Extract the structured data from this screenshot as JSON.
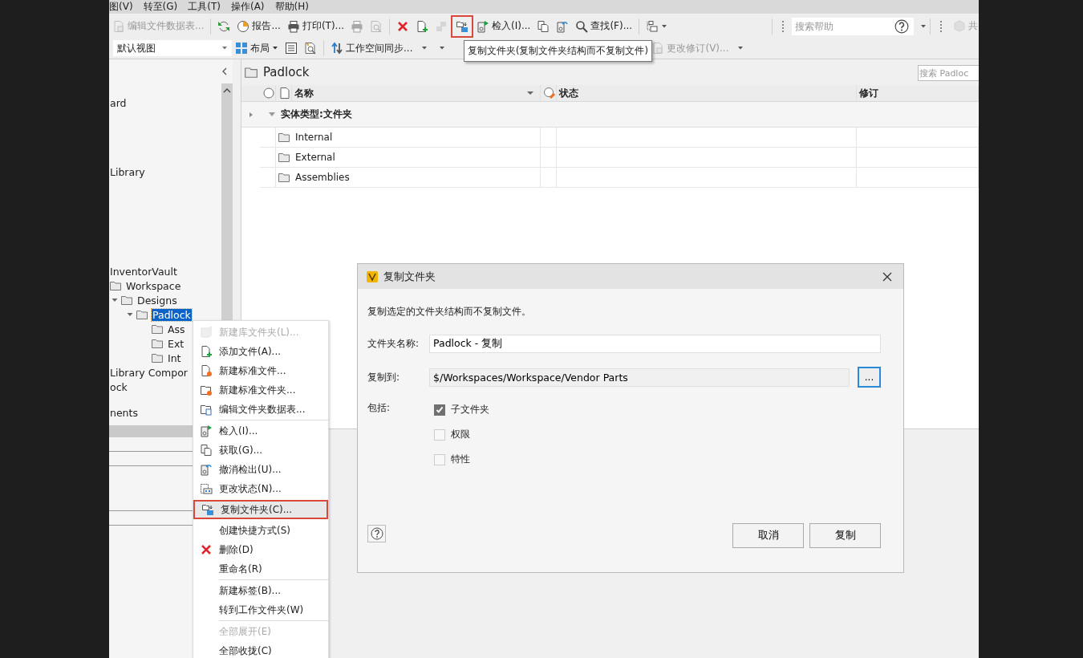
{
  "menu_bar": [
    "图(V)",
    "转至(G)",
    "工具(T)",
    "操作(A)",
    "帮助(H)"
  ],
  "toolbar": [
    {
      "kind": "button",
      "label": "编辑文件数据表...",
      "disabled": true
    },
    {
      "kind": "separator"
    },
    {
      "kind": "icon",
      "disabled": false
    },
    {
      "kind": "button",
      "label": "报告...",
      "disabled": false
    },
    {
      "kind": "button",
      "label": "打印(T)...",
      "disabled": false
    },
    {
      "kind": "icon",
      "disabled": true
    },
    {
      "kind": "icon",
      "disabled": true
    },
    {
      "kind": "separator"
    },
    {
      "kind": "icon",
      "disabled": false
    },
    {
      "kind": "icon",
      "disabled": false
    },
    {
      "kind": "icon",
      "disabled": true
    },
    {
      "kind": "icon",
      "disabled": false,
      "highlighted": true
    },
    {
      "kind": "button",
      "label": "检入(I)...",
      "disabled": false
    },
    {
      "kind": "icon",
      "disabled": false
    },
    {
      "kind": "icon",
      "disabled": false
    },
    {
      "kind": "button",
      "label": "查找(F)...",
      "disabled": false
    },
    {
      "kind": "separator"
    },
    {
      "kind": "icon-menu",
      "disabled": false
    }
  ],
  "help_search": {
    "placeholder": "搜索帮助"
  },
  "toolbar_cut_label": "共",
  "toolbar2": [
    {
      "kind": "dropdown",
      "value": "默认视图"
    },
    {
      "kind": "menu-button",
      "label": "布局"
    },
    {
      "kind": "icon"
    },
    {
      "kind": "icon"
    },
    {
      "kind": "separator"
    },
    {
      "kind": "button",
      "label": "工作空间同步...",
      "disabled": false
    },
    {
      "kind": "caret"
    },
    {
      "kind": "caret"
    },
    {
      "kind": "button",
      "label": "更改修订(V)...",
      "disabled": true
    },
    {
      "kind": "caret"
    }
  ],
  "tooltip": "复制文件夹(复制文件夹结构而不复制文件)",
  "tree": [
    {
      "label": "ard",
      "selected": false
    },
    {
      "label": "Library",
      "selected": false
    },
    {
      "label": "InventorVault",
      "selected": false,
      "children": [
        {
          "label": "Workspace",
          "selected": false,
          "children": [
            {
              "label": "Designs",
              "expanded": true,
              "selected": false,
              "children": [
                {
                  "label": "Padlock",
                  "expanded": true,
                  "selected": true,
                  "children": [
                    {
                      "label": "Ass",
                      "selected": false
                    },
                    {
                      "label": "Ext",
                      "selected": false
                    },
                    {
                      "label": "Int",
                      "selected": false
                    }
                  ]
                }
              ]
            }
          ]
        }
      ]
    },
    {
      "label": "Library Compor",
      "selected": false
    },
    {
      "label": "ock",
      "selected": false
    },
    {
      "label": "nents",
      "selected": false
    }
  ],
  "main": {
    "title": "Padlock",
    "search": {
      "placeholder": "搜索 Padloc"
    },
    "table": {
      "columns": [
        "名称",
        "状态",
        "修订"
      ],
      "group": "实体类型:文件夹",
      "rows": [
        {
          "name": "Internal"
        },
        {
          "name": "External"
        },
        {
          "name": "Assemblies"
        }
      ]
    }
  },
  "context_menu": [
    {
      "label": "新建库文件夹(L)...",
      "disabled": true,
      "separator_before": false
    },
    {
      "label": "添加文件(A)...",
      "disabled": false,
      "separator_before": false
    },
    {
      "label": "新建标准文件...",
      "disabled": false,
      "separator_before": false
    },
    {
      "label": "新建标准文件夹...",
      "disabled": false,
      "separator_before": false
    },
    {
      "label": "编辑文件夹数据表...",
      "disabled": false,
      "separator_before": false
    },
    {
      "label": "检入(I)...",
      "disabled": false,
      "separator_before": true
    },
    {
      "label": "获取(G)...",
      "disabled": false,
      "separator_before": false
    },
    {
      "label": "撤消检出(U)...",
      "disabled": false,
      "separator_before": false
    },
    {
      "label": "更改状态(N)...",
      "disabled": false,
      "separator_before": false
    },
    {
      "label": "复制文件夹(C)...",
      "disabled": false,
      "separator_before": false,
      "highlighted": true
    },
    {
      "label": "创建快捷方式(S)",
      "disabled": false,
      "separator_before": false
    },
    {
      "label": "删除(D)",
      "disabled": false,
      "separator_before": false
    },
    {
      "label": "重命名(R)",
      "disabled": false,
      "separator_before": false
    },
    {
      "label": "新建标签(B)...",
      "disabled": false,
      "separator_before": true
    },
    {
      "label": "转到工作文件夹(W)",
      "disabled": false,
      "separator_before": false
    },
    {
      "label": "全部展开(E)",
      "disabled": true,
      "separator_before": true
    },
    {
      "label": "全部收拢(C)",
      "disabled": false,
      "separator_before": false
    }
  ],
  "dialog": {
    "title": "复制文件夹",
    "description": "复制选定的文件夹结构而不复制文件。",
    "name_label": "文件夹名称:",
    "name_value": "Padlock - 复制",
    "target_label": "复制到:",
    "target_value": "$/Workspaces/Workspace/Vendor Parts",
    "browse": "...",
    "include_label": "包括:",
    "options": [
      {
        "label": "子文件夹",
        "checked": true
      },
      {
        "label": "权限",
        "checked": false
      },
      {
        "label": "特性",
        "checked": false
      }
    ],
    "buttons": [
      "取消",
      "复制"
    ]
  }
}
